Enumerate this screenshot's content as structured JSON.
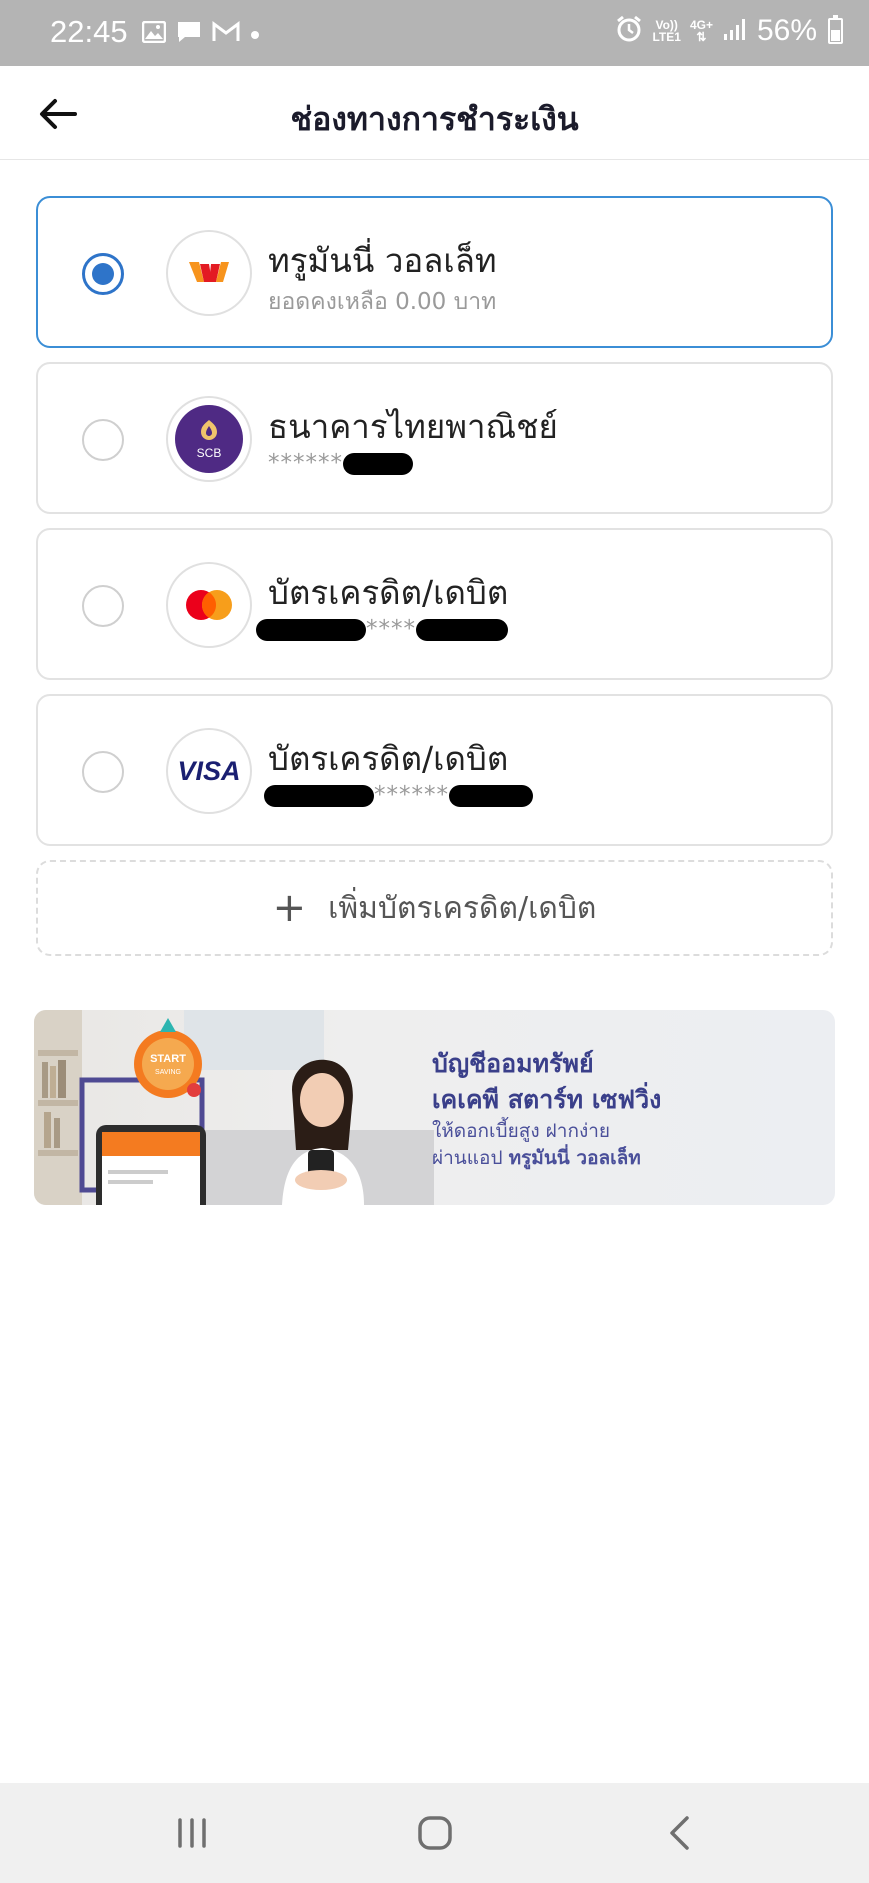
{
  "status_bar": {
    "time": "22:45",
    "battery": "56%",
    "network_line1": "Vo))",
    "network_line2": "LTE1",
    "net_type": "4G+"
  },
  "header": {
    "title": "ช่องทางการชำระเงิน"
  },
  "payment_options": [
    {
      "title": "ทรูมันนี่ วอลเล็ท",
      "subtitle": "ยอดคงเหลือ 0.00 บาท",
      "selected": true,
      "logo": "truemoney-wallet-logo"
    },
    {
      "title": "ธนาคารไทยพาณิชย์",
      "masked": "******",
      "selected": false,
      "logo": "scb-logo",
      "logo_text": "SCB"
    },
    {
      "title": "บัตรเครดิต/เดบิต",
      "masked": "****",
      "selected": false,
      "logo": "mastercard-logo"
    },
    {
      "title": "บัตรเครดิต/เดบิต",
      "masked": "******",
      "selected": false,
      "logo": "visa-logo",
      "logo_text": "VISA"
    }
  ],
  "add_card": {
    "label": "เพิ่มบัตรเครดิต/เดบิต"
  },
  "banner": {
    "line1": "บัญชีออมทรัพย์",
    "line2": "เคเคพี สตาร์ท เซฟวิ่ง",
    "line3": "ให้ดอกเบี้ยสูง ฝากง่าย",
    "line4_prefix": "ผ่านแอป ",
    "line4_strong": "ทรูมันนี่ วอลเล็ท",
    "badge_line1": "START",
    "badge_line2": "SAVING"
  },
  "colors": {
    "accent": "#2e74c9",
    "selected_border": "#3b8ed6",
    "banner_text": "#3a3f8a",
    "status_bar": "#b4b4b4"
  }
}
